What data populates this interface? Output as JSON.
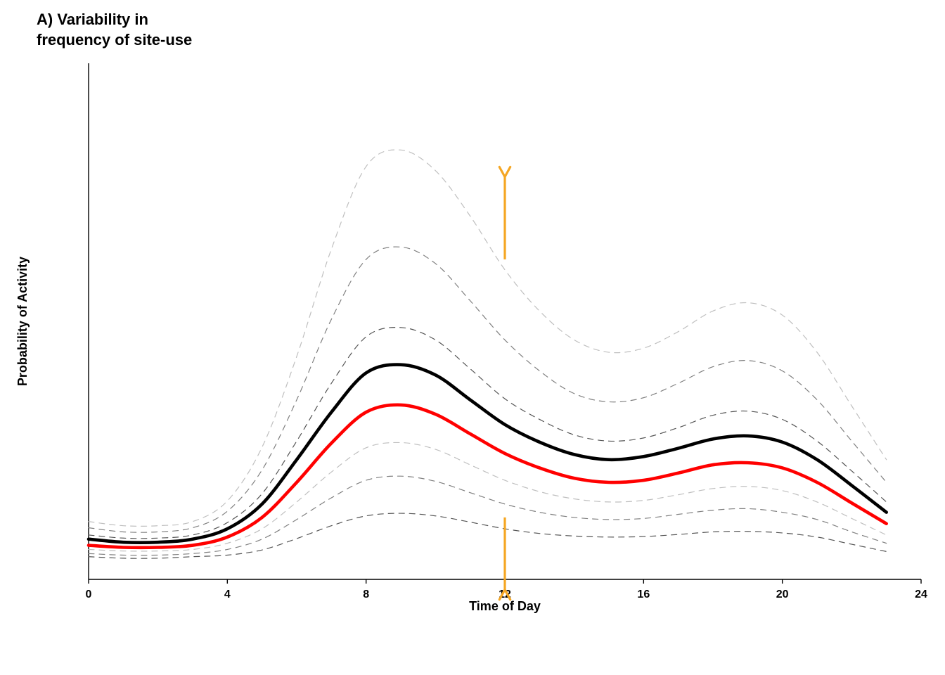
{
  "chart_data": {
    "type": "line",
    "title": "A) Variability in\nfrequency of site-use",
    "xlabel": "Time of Day",
    "ylabel": "Probability of Activity",
    "xlim": [
      0,
      24
    ],
    "ylim": [
      0,
      1
    ],
    "xticks": [
      0,
      4,
      8,
      12,
      16,
      20,
      24
    ],
    "x": [
      0,
      1,
      2,
      3,
      4,
      5,
      6,
      7,
      8,
      9,
      10,
      11,
      12,
      13,
      14,
      15,
      16,
      17,
      18,
      19,
      20,
      21,
      22,
      23
    ],
    "series": [
      {
        "name": "dashed_high3",
        "style": "dashed",
        "color": "#bfbfbf",
        "width": 1.2,
        "values": [
          0.112,
          0.104,
          0.104,
          0.112,
          0.152,
          0.256,
          0.432,
          0.64,
          0.8,
          0.832,
          0.792,
          0.704,
          0.6,
          0.52,
          0.464,
          0.44,
          0.448,
          0.48,
          0.52,
          0.536,
          0.512,
          0.44,
          0.336,
          0.232
        ]
      },
      {
        "name": "dashed_high2",
        "style": "dashed",
        "color": "#808080",
        "width": 1.2,
        "values": [
          0.1,
          0.092,
          0.092,
          0.1,
          0.132,
          0.212,
          0.348,
          0.504,
          0.62,
          0.644,
          0.612,
          0.54,
          0.464,
          0.404,
          0.36,
          0.344,
          0.352,
          0.38,
          0.412,
          0.424,
          0.404,
          0.348,
          0.268,
          0.188
        ]
      },
      {
        "name": "dashed_high1",
        "style": "dashed",
        "color": "#555555",
        "width": 1.2,
        "values": [
          0.086,
          0.08,
          0.08,
          0.086,
          0.11,
          0.166,
          0.268,
          0.38,
          0.47,
          0.488,
          0.464,
          0.408,
          0.35,
          0.31,
          0.28,
          0.268,
          0.274,
          0.294,
          0.318,
          0.326,
          0.31,
          0.268,
          0.21,
          0.15
        ]
      },
      {
        "name": "solid_black",
        "style": "solid",
        "color": "#000000",
        "width": 4.6,
        "values": [
          0.078,
          0.072,
          0.072,
          0.078,
          0.098,
          0.146,
          0.232,
          0.324,
          0.4,
          0.416,
          0.396,
          0.348,
          0.3,
          0.266,
          0.242,
          0.232,
          0.238,
          0.254,
          0.272,
          0.278,
          0.266,
          0.232,
          0.182,
          0.13
        ]
      },
      {
        "name": "solid_red",
        "style": "solid",
        "color": "#ff0000",
        "width": 4.6,
        "values": [
          0.066,
          0.062,
          0.062,
          0.066,
          0.082,
          0.12,
          0.188,
          0.264,
          0.324,
          0.338,
          0.32,
          0.282,
          0.244,
          0.216,
          0.196,
          0.188,
          0.192,
          0.206,
          0.222,
          0.226,
          0.216,
          0.188,
          0.148,
          0.108
        ]
      },
      {
        "name": "dashed_low1",
        "style": "dashed",
        "color": "#bfbfbf",
        "width": 1.2,
        "values": [
          0.058,
          0.055,
          0.055,
          0.058,
          0.07,
          0.098,
          0.15,
          0.208,
          0.255,
          0.265,
          0.252,
          0.222,
          0.192,
          0.17,
          0.156,
          0.15,
          0.153,
          0.164,
          0.176,
          0.18,
          0.172,
          0.15,
          0.118,
          0.086
        ]
      },
      {
        "name": "dashed_low2",
        "style": "dashed",
        "color": "#808080",
        "width": 1.2,
        "values": [
          0.05,
          0.047,
          0.047,
          0.05,
          0.058,
          0.078,
          0.116,
          0.158,
          0.192,
          0.2,
          0.19,
          0.168,
          0.146,
          0.13,
          0.12,
          0.116,
          0.118,
          0.126,
          0.134,
          0.137,
          0.13,
          0.116,
          0.092,
          0.07
        ]
      },
      {
        "name": "dashed_low3",
        "style": "dashed",
        "color": "#555555",
        "width": 1.2,
        "values": [
          0.044,
          0.041,
          0.041,
          0.044,
          0.047,
          0.057,
          0.079,
          0.104,
          0.123,
          0.128,
          0.123,
          0.111,
          0.098,
          0.089,
          0.084,
          0.082,
          0.083,
          0.087,
          0.092,
          0.093,
          0.09,
          0.082,
          0.068,
          0.054
        ]
      }
    ],
    "arrows": [
      {
        "name": "arrow-up",
        "x": 12,
        "y0": 0.62,
        "y1": 0.78,
        "color": "#f5a623"
      },
      {
        "name": "arrow-down",
        "x": 12,
        "y0": 0.12,
        "y1": -0.02,
        "color": "#f5a623"
      }
    ]
  }
}
